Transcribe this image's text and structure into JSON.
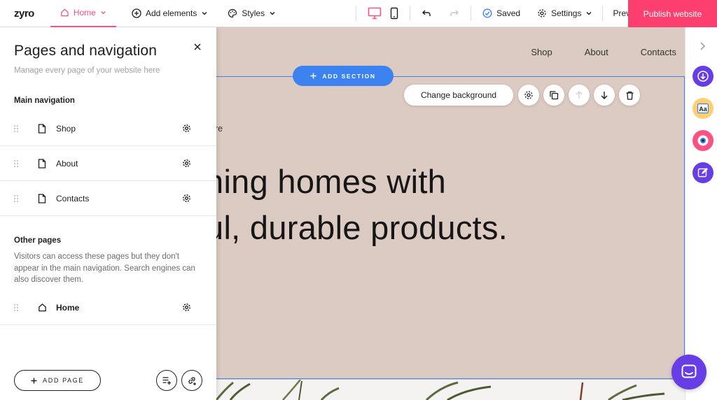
{
  "app": {
    "logo": "zyro"
  },
  "toolbar": {
    "home_label": "Home",
    "add_elements_label": "Add elements",
    "styles_label": "Styles",
    "saved_label": "Saved",
    "settings_label": "Settings",
    "preview_label": "Preview",
    "publish_label": "Publish website"
  },
  "panel": {
    "title": "Pages and navigation",
    "subtitle": "Manage every page of your website here",
    "main_nav_heading": "Main navigation",
    "main_nav": [
      {
        "label": "Shop"
      },
      {
        "label": "About"
      },
      {
        "label": "Contacts"
      }
    ],
    "other_heading": "Other pages",
    "other_desc": "Visitors can access these pages but they don't appear in the main navigation. Search engines can also discover them.",
    "other_pages": [
      {
        "label": "Home"
      }
    ],
    "add_page_label": "ADD PAGE"
  },
  "canvas": {
    "site_nav": [
      "Shop",
      "About",
      "Contacts"
    ],
    "add_section_label": "ADD SECTION",
    "change_bg_label": "Change background",
    "eyebrow_fragment": "re",
    "headline_line1": "ning homes with",
    "headline_line2": "ul, durable products."
  },
  "colors": {
    "accent": "#fc5185",
    "publish": "#fc3f6e",
    "selection": "#3c82f0",
    "canvas_bg": "#dccbc2",
    "chat": "#673de6"
  },
  "icons": {
    "rail": [
      "download-circle-icon",
      "typography-icon",
      "eye-icon",
      "edit-icon"
    ]
  }
}
